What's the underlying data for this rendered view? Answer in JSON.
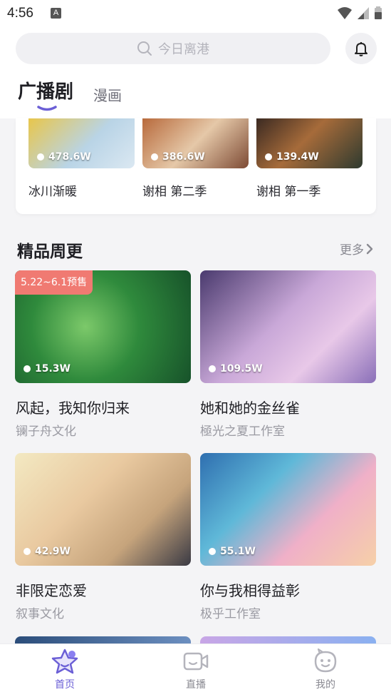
{
  "status_bar": {
    "time": "4:56",
    "notification_icon": "A"
  },
  "search": {
    "placeholder": "今日离港"
  },
  "tabs": [
    {
      "label": "广播剧",
      "active": true
    },
    {
      "label": "漫画",
      "active": false
    }
  ],
  "history_row": [
    {
      "title": "冰川渐暖",
      "plays": "478.6W"
    },
    {
      "title": "谢相 第二季",
      "plays": "386.6W"
    },
    {
      "title": "谢相 第一季",
      "plays": "139.4W"
    }
  ],
  "section": {
    "title": "精品周更",
    "more_label": "更多"
  },
  "grid": [
    {
      "title": "风起，我知你归来",
      "studio": "镧子舟文化",
      "plays": "15.3W",
      "badge": "5.22~6.1预售"
    },
    {
      "title": "她和她的金丝雀",
      "studio": "極光之夏工作室",
      "plays": "109.5W"
    },
    {
      "title": "非限定恋爱",
      "studio": "叙事文化",
      "plays": "42.9W"
    },
    {
      "title": "你与我相得益彰",
      "studio": "极乎工作室",
      "plays": "55.1W"
    }
  ],
  "bottom_nav": [
    {
      "label": "首页",
      "icon": "star-face-icon",
      "active": true
    },
    {
      "label": "直播",
      "icon": "video-camera-icon",
      "active": false
    },
    {
      "label": "我的",
      "icon": "smiley-face-icon",
      "active": false
    }
  ],
  "colors": {
    "accent": "#6b5fd6",
    "badge": "#f07a72",
    "text": "#1f1f24",
    "muted": "#9a9aa2"
  }
}
